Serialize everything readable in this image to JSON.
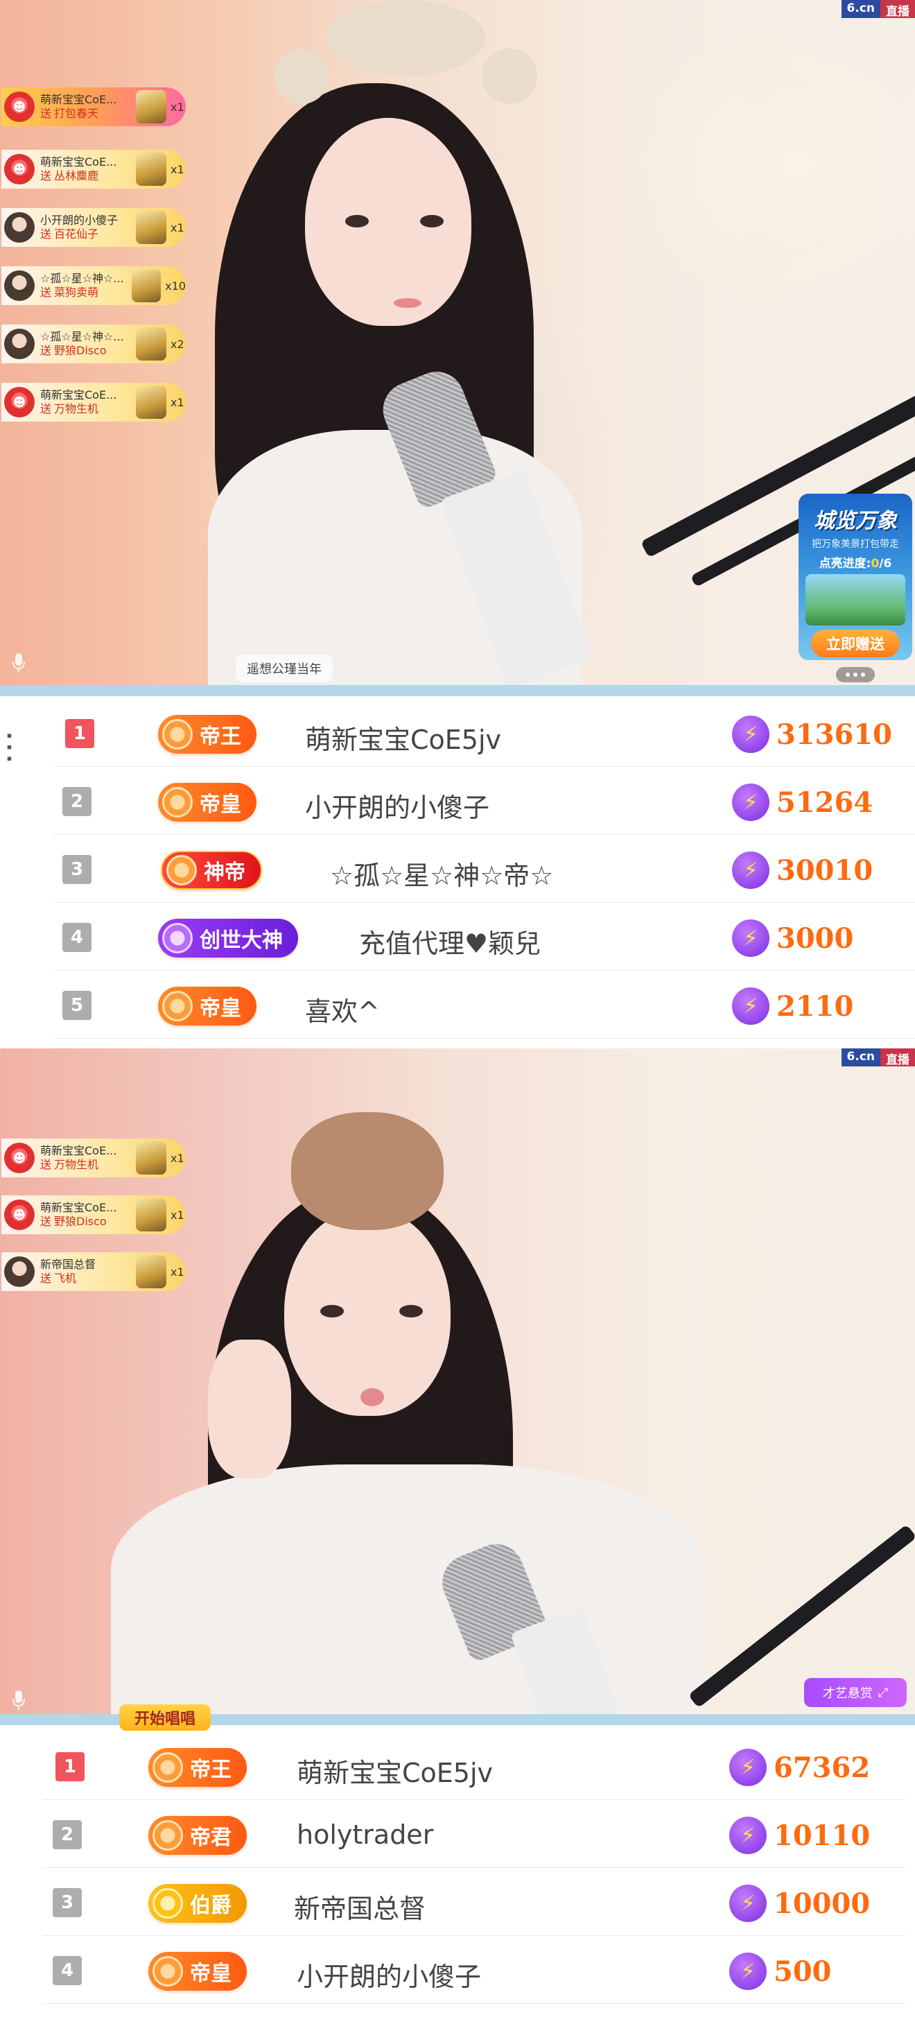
{
  "logo": {
    "left": "6.cn",
    "right": "直播"
  },
  "video1": {
    "gifts": [
      {
        "name": "萌新宝宝CoE...",
        "action": "送",
        "gift": "打包春天",
        "count": "x1",
        "avatar": "red",
        "hot": true
      },
      {
        "name": "萌新宝宝CoE...",
        "action": "送",
        "gift": "丛林麋鹿",
        "count": "x1",
        "avatar": "red",
        "hot": false
      },
      {
        "name": "小开朗的小傻子",
        "action": "送",
        "gift": "百花仙子",
        "count": "x1",
        "avatar": "photo",
        "hot": false
      },
      {
        "name": "☆孤☆星☆神☆...",
        "action": "送",
        "gift": "菜狗卖萌",
        "count": "x10",
        "avatar": "photo",
        "hot": false
      },
      {
        "name": "☆孤☆星☆神☆...",
        "action": "送",
        "gift": "野狼Disco",
        "count": "x2",
        "avatar": "photo",
        "hot": false
      },
      {
        "name": "萌新宝宝CoE...",
        "action": "送",
        "gift": "万物生机",
        "count": "x1",
        "avatar": "red",
        "hot": false
      }
    ],
    "tag": "遥想公瑾当年",
    "promo": {
      "title": "城览万象",
      "desc": "把万象美景打包带走",
      "progress_label": "点亮进度:",
      "progress_value": "0",
      "progress_total": "/6",
      "button": "立即赠送"
    }
  },
  "rank1": [
    {
      "rank": "1",
      "badge": "帝王",
      "style": "orange",
      "name": "萌新宝宝CoE5jv",
      "score": "313610"
    },
    {
      "rank": "2",
      "badge": "帝皇",
      "style": "orange",
      "name": "小开朗的小傻子",
      "score": "51264"
    },
    {
      "rank": "3",
      "badge": "神帝",
      "style": "red",
      "name": "☆孤☆星☆神☆帝☆",
      "score": "30010"
    },
    {
      "rank": "4",
      "badge": "创世大神",
      "style": "purple",
      "name": "充值代理♥颖兒",
      "score": "3000"
    },
    {
      "rank": "5",
      "badge": "帝皇",
      "style": "orange",
      "name": "喜欢^",
      "score": "2110"
    }
  ],
  "video2": {
    "gifts": [
      {
        "name": "萌新宝宝CoE...",
        "action": "送",
        "gift": "万物生机",
        "count": "x1",
        "avatar": "red",
        "hot": false
      },
      {
        "name": "萌新宝宝CoE...",
        "action": "送",
        "gift": "野狼Disco",
        "count": "x1",
        "avatar": "red",
        "hot": false
      },
      {
        "name": "新帝国总督",
        "action": "送",
        "gift": "飞机",
        "count": "x1",
        "avatar": "photo",
        "hot": false
      }
    ],
    "talent_button": "才艺悬赏",
    "song_tab": "开始唱唱"
  },
  "rank2": [
    {
      "rank": "1",
      "badge": "帝王",
      "style": "orange",
      "name": "萌新宝宝CoE5jv",
      "score": "67362"
    },
    {
      "rank": "2",
      "badge": "帝君",
      "style": "orange",
      "name": "holytrader",
      "score": "10110"
    },
    {
      "rank": "3",
      "badge": "伯爵",
      "style": "gold",
      "name": "新帝国总督",
      "score": "10000"
    },
    {
      "rank": "4",
      "badge": "帝皇",
      "style": "orange",
      "name": "小开朗的小傻子",
      "score": "500"
    }
  ],
  "colors": {
    "accent": "#ff6a10",
    "rank_first": "#f0545c",
    "rank_other": "#adadad",
    "divider_strip": "#b2d7ea"
  }
}
